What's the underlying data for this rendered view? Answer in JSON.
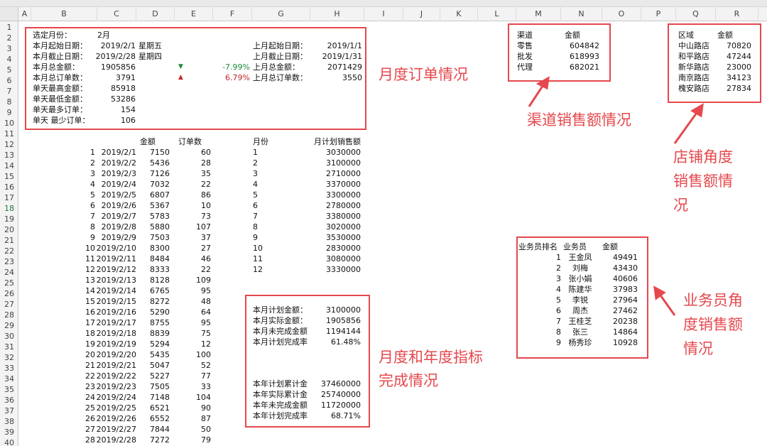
{
  "columns": [
    "A",
    "B",
    "C",
    "D",
    "E",
    "F",
    "G",
    "H",
    "I",
    "J",
    "K",
    "L",
    "M",
    "N",
    "O",
    "P",
    "Q",
    "R"
  ],
  "rows": [
    "1",
    "2",
    "3",
    "4",
    "5",
    "6",
    "7",
    "8",
    "9",
    "10",
    "11",
    "12",
    "13",
    "14",
    "15",
    "16",
    "17",
    "18",
    "19",
    "20",
    "21",
    "22",
    "23",
    "24",
    "25",
    "26",
    "27",
    "28",
    "29",
    "30",
    "31",
    "32",
    "33",
    "34",
    "35",
    "36",
    "37",
    "38",
    "39",
    "40"
  ],
  "active_row": "18",
  "monthly_summary": {
    "selected_month_label": "选定月份：",
    "selected_month": "2月",
    "start_label": "本月起始日期：",
    "start_date": "2019/2/1",
    "start_weekday": "星期五",
    "end_label": "本月截止日期：",
    "end_date": "2019/2/28",
    "end_weekday": "星期四",
    "total_amount_label": "本月总金额：",
    "total_amount": "1905856",
    "amount_change": "-7.99%",
    "total_orders_label": "本月总订单数：",
    "total_orders": "3791",
    "orders_change": "6.79%",
    "max_amount_label": "单天最高金额：",
    "max_amount": "85918",
    "min_amount_label": "单天最低金额：",
    "min_amount": "53286",
    "max_orders_label": "单天最多订单：",
    "max_orders": "154",
    "min_orders_label": "单天 最少订单：",
    "min_orders": "106",
    "prev_start_label": "上月起始日期：",
    "prev_start_date": "2019/1/1",
    "prev_end_label": "上月截止日期：",
    "prev_end_date": "2019/1/31",
    "prev_amount_label": "上月总金额：",
    "prev_amount": "2071429",
    "prev_orders_label": "上月总订单数：",
    "prev_orders": "3550",
    "colors": {
      "up": "#c0282a",
      "down": "#1f8a3a"
    }
  },
  "daily": {
    "header_amount": "金额",
    "header_orders": "订单数",
    "rows": [
      [
        "1",
        "2019/2/1",
        "7150",
        "60"
      ],
      [
        "2",
        "2019/2/2",
        "5436",
        "28"
      ],
      [
        "3",
        "2019/2/3",
        "7126",
        "35"
      ],
      [
        "4",
        "2019/2/4",
        "7032",
        "22"
      ],
      [
        "5",
        "2019/2/5",
        "6807",
        "86"
      ],
      [
        "6",
        "2019/2/6",
        "5367",
        "10"
      ],
      [
        "7",
        "2019/2/7",
        "5783",
        "73"
      ],
      [
        "8",
        "2019/2/8",
        "5880",
        "107"
      ],
      [
        "9",
        "2019/2/9",
        "7503",
        "37"
      ],
      [
        "10",
        "2019/2/10",
        "8300",
        "27"
      ],
      [
        "11",
        "2019/2/11",
        "8484",
        "46"
      ],
      [
        "12",
        "2019/2/12",
        "8333",
        "22"
      ],
      [
        "13",
        "2019/2/13",
        "8128",
        "109"
      ],
      [
        "14",
        "2019/2/14",
        "6765",
        "95"
      ],
      [
        "15",
        "2019/2/15",
        "8272",
        "48"
      ],
      [
        "16",
        "2019/2/16",
        "5290",
        "64"
      ],
      [
        "17",
        "2019/2/17",
        "8755",
        "95"
      ],
      [
        "18",
        "2019/2/18",
        "8839",
        "75"
      ],
      [
        "19",
        "2019/2/19",
        "5294",
        "12"
      ],
      [
        "20",
        "2019/2/20",
        "5435",
        "100"
      ],
      [
        "21",
        "2019/2/21",
        "5047",
        "52"
      ],
      [
        "22",
        "2019/2/22",
        "5227",
        "77"
      ],
      [
        "23",
        "2019/2/23",
        "7505",
        "33"
      ],
      [
        "24",
        "2019/2/24",
        "7148",
        "104"
      ],
      [
        "25",
        "2019/2/25",
        "6521",
        "90"
      ],
      [
        "26",
        "2019/2/26",
        "6552",
        "87"
      ],
      [
        "27",
        "2019/2/27",
        "7844",
        "50"
      ],
      [
        "28",
        "2019/2/28",
        "7272",
        "79"
      ]
    ]
  },
  "monthly_plan": {
    "header_month": "月份",
    "header_plan": "月计划销售额",
    "rows": [
      [
        "1",
        "3030000"
      ],
      [
        "2",
        "3100000"
      ],
      [
        "3",
        "2710000"
      ],
      [
        "4",
        "3370000"
      ],
      [
        "5",
        "3300000"
      ],
      [
        "6",
        "2780000"
      ],
      [
        "7",
        "3380000"
      ],
      [
        "8",
        "3020000"
      ],
      [
        "9",
        "3530000"
      ],
      [
        "10",
        "2830000"
      ],
      [
        "11",
        "3080000"
      ],
      [
        "12",
        "3330000"
      ]
    ]
  },
  "targets": {
    "rows_month": [
      [
        "本月计划金额：",
        "3100000"
      ],
      [
        "本月实际金额：",
        "1905856"
      ],
      [
        "本月未完成金额",
        "1194144"
      ],
      [
        "本月计划完成率",
        "61.48%"
      ]
    ],
    "rows_year": [
      [
        "本年计划累计金",
        "37460000"
      ],
      [
        "本年实际累计金",
        "25740000"
      ],
      [
        "本年未完成金额",
        "11720000"
      ],
      [
        "本年计划完成率",
        "68.71%"
      ]
    ]
  },
  "channels": {
    "header_channel": "渠道",
    "header_amount": "金额",
    "rows": [
      [
        "零售",
        "604842"
      ],
      [
        "批发",
        "618993"
      ],
      [
        "代理",
        "682021"
      ]
    ]
  },
  "stores": {
    "header_area": "区域",
    "header_amount": "金额",
    "rows": [
      [
        "中山路店",
        "70820"
      ],
      [
        "和平路店",
        "47244"
      ],
      [
        "新华路店",
        "23000"
      ],
      [
        "南京路店",
        "34123"
      ],
      [
        "槐安路店",
        "27834"
      ]
    ]
  },
  "salespeople": {
    "header_rank": "业务员排名",
    "header_name": "业务员",
    "header_amount": "金额",
    "rows": [
      [
        "1",
        "王金凤",
        "49491"
      ],
      [
        "2",
        "刘梅",
        "43430"
      ],
      [
        "3",
        "张小娟",
        "40606"
      ],
      [
        "4",
        "陈建华",
        "37983"
      ],
      [
        "5",
        "李锐",
        "27964"
      ],
      [
        "6",
        "周杰",
        "27462"
      ],
      [
        "7",
        "王桂芝",
        "20238"
      ],
      [
        "8",
        "张三",
        "14864"
      ],
      [
        "9",
        "杨秀珍",
        "10928"
      ]
    ]
  },
  "annotations": {
    "monthly_orders": "月度订单情况",
    "channel_sales": "渠道销售额情况",
    "store_sales_1": "店铺角度",
    "store_sales_2": "销售额情",
    "store_sales_3": "况",
    "sales_rep_1": "业务员角",
    "sales_rep_2": "度销售额",
    "sales_rep_3": "情况",
    "targets_1": "月度和年度指标",
    "targets_2": "完成情况",
    "color": "#e5484d"
  }
}
